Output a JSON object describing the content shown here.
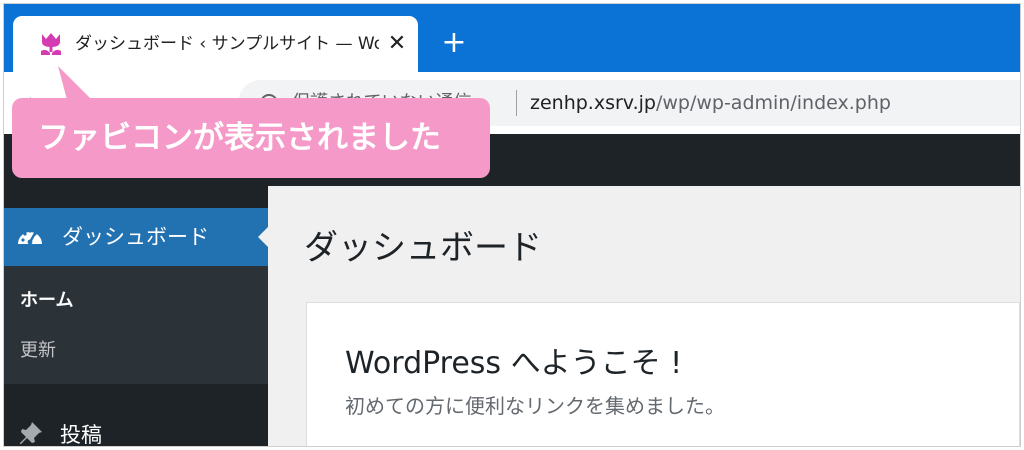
{
  "browser": {
    "tab": {
      "title": "ダッシュボード ‹ サンプルサイト — WordPress",
      "favicon": "tulip-favicon-icon",
      "close_label": "✕"
    },
    "new_tab_label": "+",
    "address": {
      "security_text": "保護されていない通信",
      "url_host": "zenhp.xsrv.jp",
      "url_path": "/wp/wp-admin/index.php"
    }
  },
  "callout": {
    "text": "ファビコンが表示されました",
    "color": "#f59ac8"
  },
  "sidebar": {
    "dashboard_label": "ダッシュボード",
    "submenu": {
      "home": "ホーム",
      "update": "更新"
    },
    "posts_label": "投稿"
  },
  "main": {
    "page_title": "ダッシュボード",
    "welcome": {
      "title": "WordPress へようこそ !",
      "subtitle": "初めての方に便利なリンクを集めました。"
    }
  },
  "colors": {
    "tab_strip": "#0b73d6",
    "admin_dark": "#1d2327",
    "wp_blue": "#2271b1",
    "favicon": "#d63cb1"
  }
}
